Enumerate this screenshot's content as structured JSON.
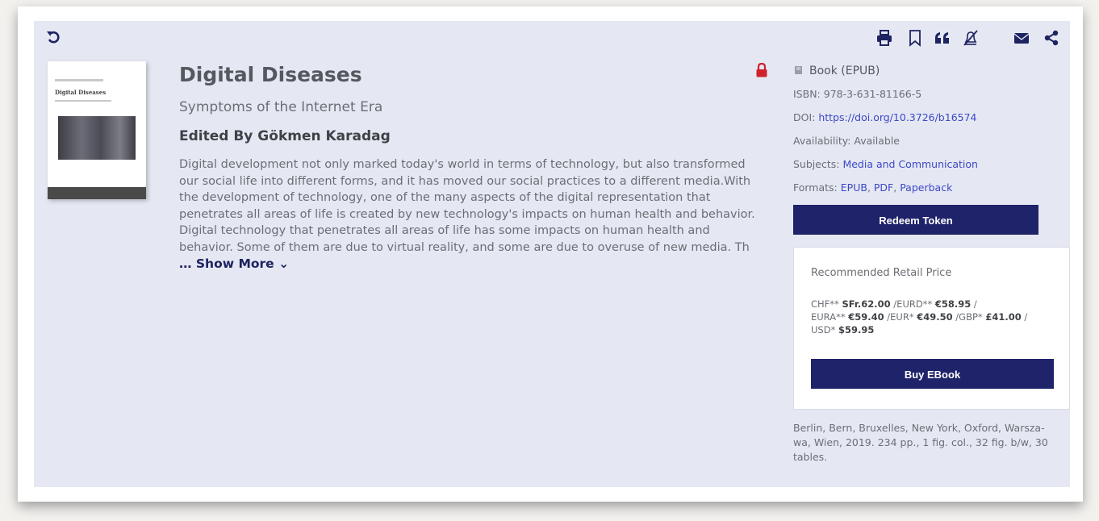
{
  "toolbar": {
    "icons": [
      "print-icon",
      "bookmark-icon",
      "quote-icon",
      "notification-off-icon",
      "email-icon",
      "share-icon"
    ]
  },
  "book": {
    "title": "Digital Diseases",
    "subtitle": "Symptoms of the Internet Era",
    "editor": "Edited By Gökmen Karadag",
    "abstract_lines": [
      "Digital development not only marked today's world in terms of technology, but also transformed",
      "our social life into different forms, and it has moved our social practices to a different media.With",
      "the development of technology, one of the many aspects of the digital representation that",
      "penetrates all areas of life is created by new technology's impacts on human health and behavior.",
      "Digital technology that penetrates all areas of life has some impacts on human health and",
      "behavior. Some of them are due to virtual reality, and some are due to overuse of new media. Th"
    ],
    "show_more": "… Show More ⌄",
    "cover": {
      "title": "Digital Diseases"
    }
  },
  "details": {
    "format": "Book (EPUB)",
    "isbn_label": "ISBN:",
    "isbn": "978-3-631-81166-5",
    "doi_label": "DOI:",
    "doi": "https://doi.org/10.3726/b16574",
    "availability_label": "Availability:",
    "availability": "Available",
    "subjects_label": "Subjects:",
    "subject": "Media and Communication",
    "formats_label": "Formats:",
    "formats": [
      "EPUB",
      "PDF",
      "Paperback"
    ]
  },
  "actions": {
    "redeem_label": "Redeem Token",
    "buy_label": "Buy EBook"
  },
  "pricing": {
    "heading": "Recommended Retail Price",
    "chf_label": "CHF**",
    "chf": "SFr.62.00",
    "eurd_label": "/EURD**",
    "eurd": "€58.95",
    "eura_label": "EURA**",
    "eura": "€59.40",
    "eur_label": "/EUR*",
    "eur": "€49.50",
    "gbp_label": "/GBP*",
    "gbp": "£41.00",
    "usd_label": "USD*",
    "usd": "$59.95"
  },
  "publication_info": "Berlin, Bern, Bruxelles, New York, Oxford, Warsza-wa, Wien, 2019. 234 pp., 1 fig. col., 32 fig. b/w, 30 tables.",
  "colors": {
    "accent": "#1f236a",
    "link": "#3c48c8",
    "panel": "#e5e8f2",
    "lock": "#d0212a"
  }
}
